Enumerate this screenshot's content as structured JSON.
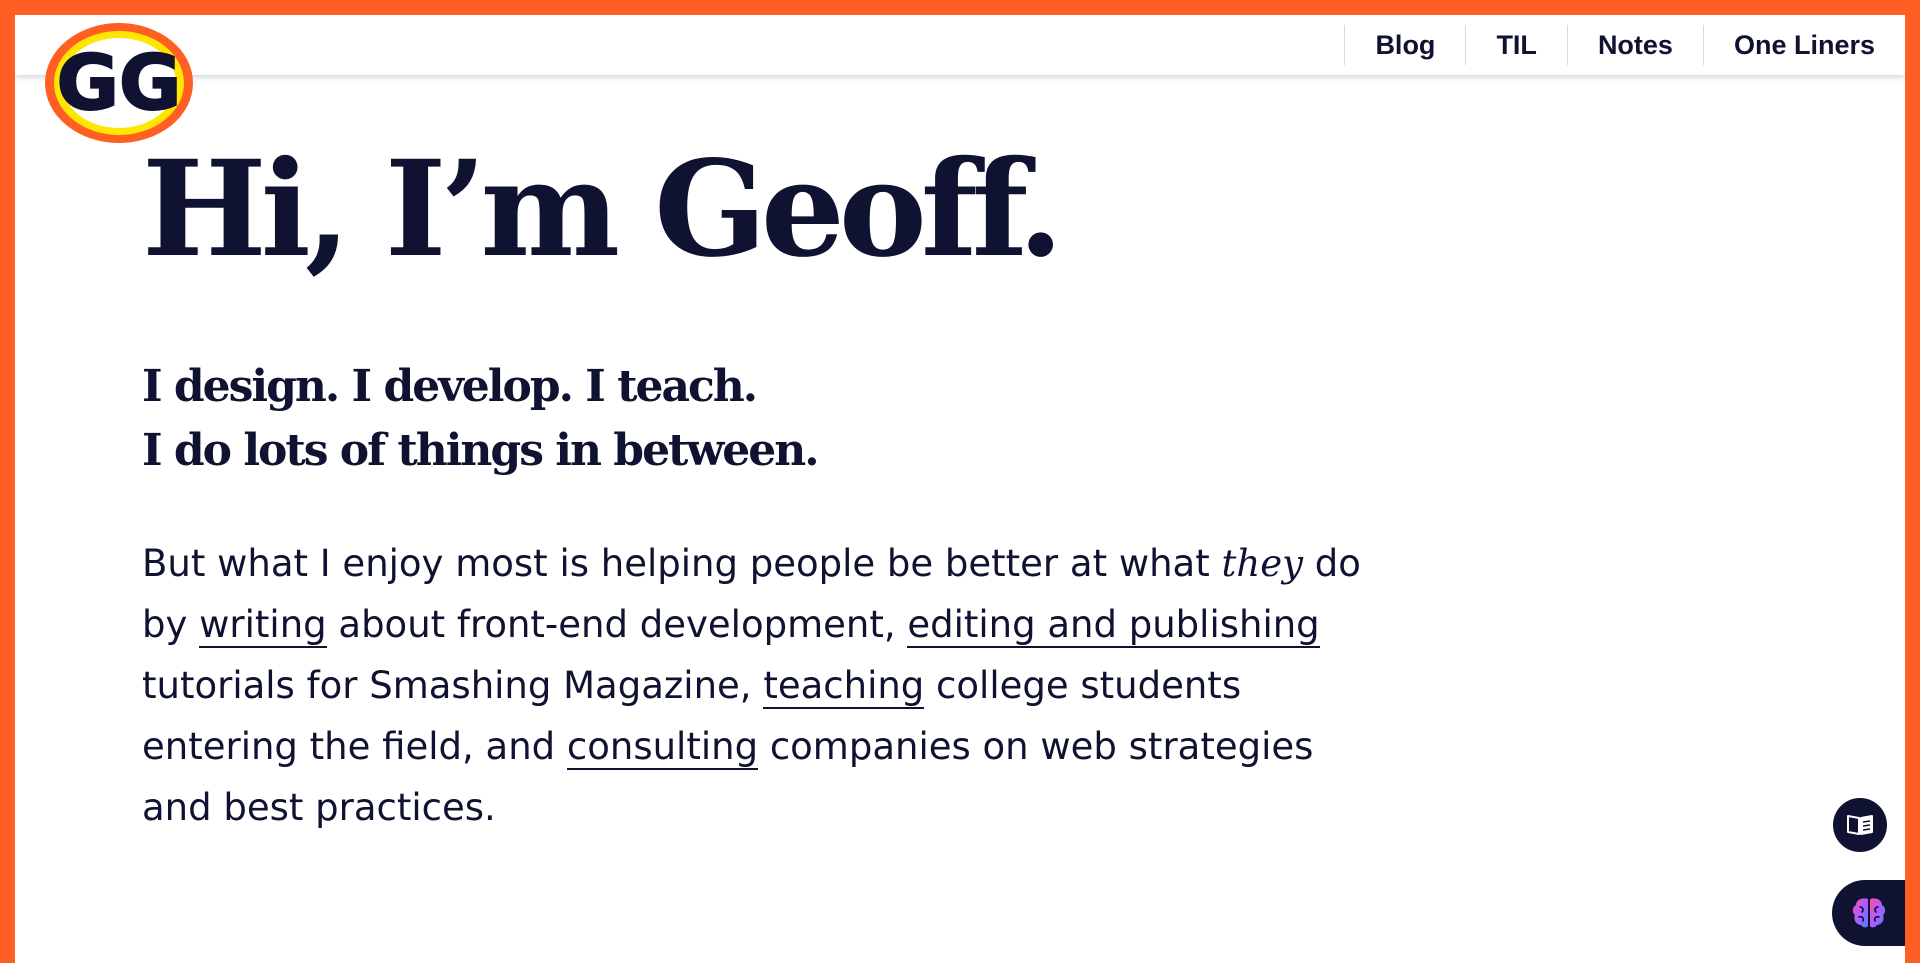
{
  "logo": {
    "text": "GG"
  },
  "nav": {
    "items": [
      {
        "label": "Blog"
      },
      {
        "label": "TIL"
      },
      {
        "label": "Notes"
      },
      {
        "label": "One Liners"
      }
    ]
  },
  "hero": {
    "title": "Hi, I’m Geoff.",
    "tagline_line1": "I design. I develop. I teach.",
    "tagline_line2": "I do lots of things in between."
  },
  "intro": {
    "t1": "But what I enjoy most is helping people be better at what ",
    "emphasis": "they",
    "t2": " do by ",
    "link_writing": "writing",
    "t3": " about front-end development, ",
    "link_editing": "editing and publishing",
    "t4": " tutorials for Smashing Magazine, ",
    "link_teaching": "teaching",
    "t5": " college students entering the field, and ",
    "link_consulting": "consulting",
    "t6": " companies on web strategies and best practices."
  },
  "floating": {
    "reader_icon": "book-icon",
    "brain_icon": "brain-icon"
  },
  "colors": {
    "accent": "#ff5f23",
    "ink": "#0f1230",
    "logo_yellow": "#ffe600"
  }
}
